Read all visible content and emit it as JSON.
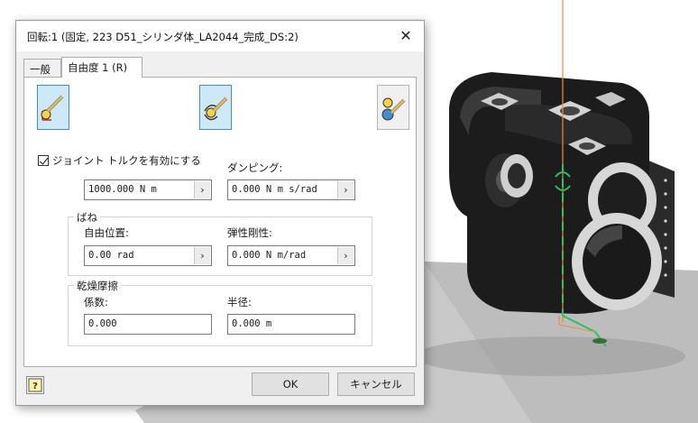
{
  "dialog": {
    "title": "回転:1 (固定, 223 D51_シリンダ体_LA2044_完成_DS:2)",
    "close_icon": "close-icon",
    "tabs": [
      {
        "label": "一般"
      },
      {
        "label": "自由度 1 (R)"
      }
    ],
    "icons": [
      "joint-insert-icon",
      "joint-rotate-icon",
      "joint-dual-icon"
    ],
    "torque_checkbox": {
      "label": "ジョイント トルクを有効にする",
      "checked": true
    },
    "torque_value": "1000.000 N m",
    "damping": {
      "label": "ダンピング:",
      "value": "0.000 N m s/rad"
    },
    "spring": {
      "title": "ばね",
      "free_position": {
        "label": "自由位置:",
        "value": "0.00 rad"
      },
      "stiffness": {
        "label": "弾性剛性:",
        "value": "0.000 N m/rad"
      }
    },
    "friction": {
      "title": "乾燥摩擦",
      "coefficient": {
        "label": "係数:",
        "value": "0.000"
      },
      "radius": {
        "label": "半径:",
        "value": "0.000 m"
      }
    },
    "field_arrow": "›",
    "help_label": "?",
    "ok_label": "OK",
    "cancel_label": "キャンセル"
  },
  "colors": {
    "accent": "#3e8ed0",
    "selected_bg": "#cde8f7",
    "joint_green": "#22c55e",
    "axis_orange": "#f08a3c"
  }
}
